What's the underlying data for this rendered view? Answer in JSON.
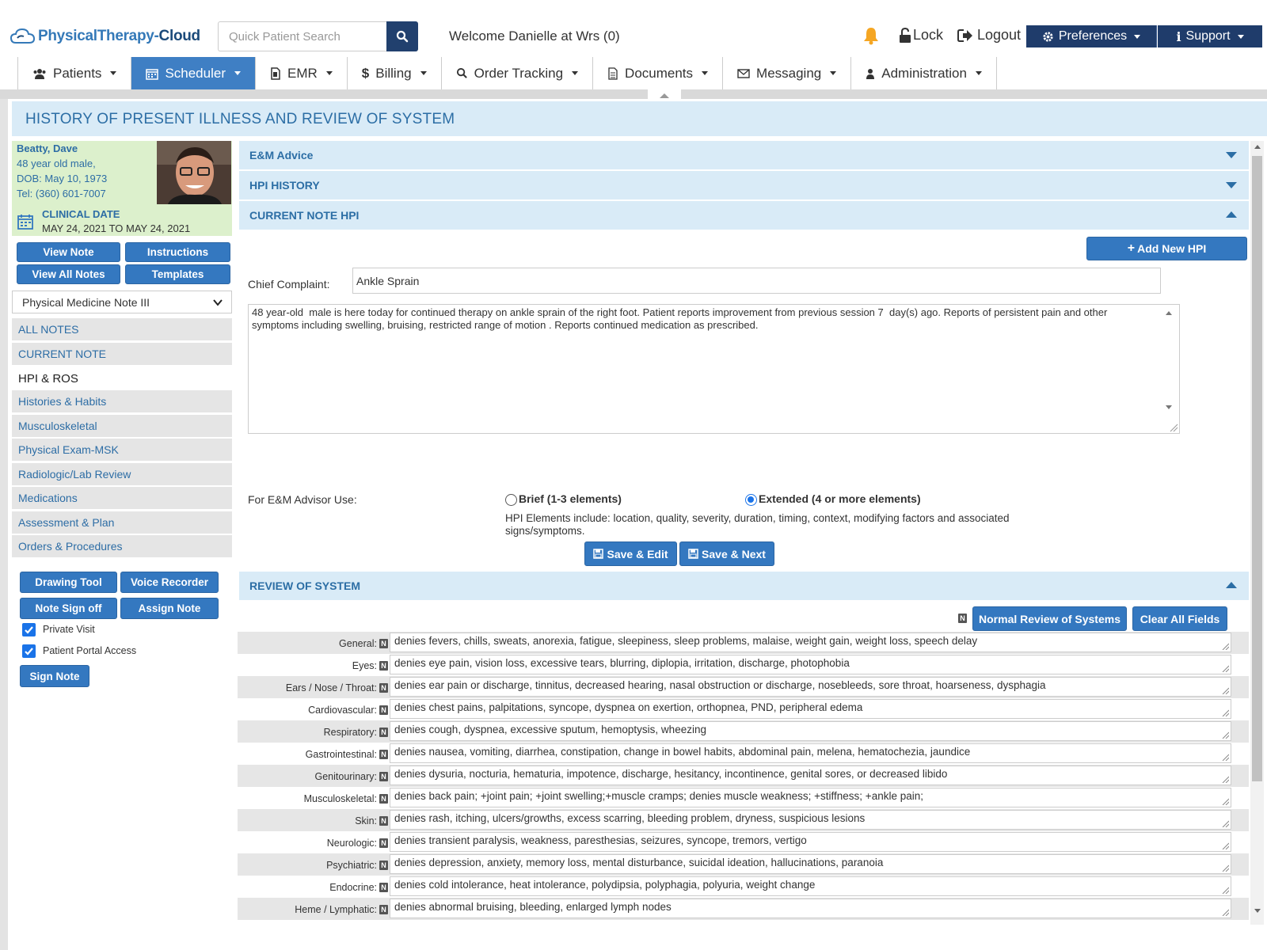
{
  "header": {
    "logo_part1": "PhysicalTherapy-",
    "logo_part2": "Cloud",
    "search_placeholder": "Quick Patient Search",
    "welcome": "Welcome Danielle at Wrs (0)",
    "lock": "Lock",
    "logout": "Logout",
    "preferences": "Preferences",
    "support": "Support"
  },
  "nav": {
    "items": [
      {
        "label": "Patients",
        "icon": "users-icon"
      },
      {
        "label": "Scheduler",
        "icon": "calendar-icon"
      },
      {
        "label": "EMR",
        "icon": "file-icon"
      },
      {
        "label": "Billing",
        "icon": "dollar-icon"
      },
      {
        "label": "Order Tracking",
        "icon": "search-icon"
      },
      {
        "label": "Documents",
        "icon": "document-icon"
      },
      {
        "label": "Messaging",
        "icon": "envelope-icon"
      },
      {
        "label": "Administration",
        "icon": "user-icon"
      }
    ],
    "active": "Scheduler"
  },
  "page": {
    "title": "HISTORY OF PRESENT ILLNESS AND REVIEW OF SYSTEM"
  },
  "patient": {
    "name": "Beatty, Dave",
    "age_sex": "48 year old male,",
    "dob": "DOB: May 10, 1973",
    "tel": "Tel: (360) 601-7007",
    "clinical_date_label": "CLINICAL DATE",
    "clinical_date_value": "MAY 24, 2021 TO MAY 24, 2021"
  },
  "sidebar": {
    "buttons": {
      "view_note": "View Note",
      "instructions": "Instructions",
      "view_all_notes": "View All Notes",
      "templates": "Templates"
    },
    "note_type": "Physical Medicine Note III",
    "items": [
      "ALL NOTES",
      "CURRENT NOTE",
      "HPI & ROS",
      "Histories & Habits",
      "Musculoskeletal",
      "Physical Exam-MSK",
      "Radiologic/Lab Review",
      "Medications",
      "Assessment & Plan",
      "Orders & Procedures"
    ],
    "current_item": "HPI & ROS",
    "tools": {
      "drawing_tool": "Drawing Tool",
      "voice_recorder": "Voice Recorder",
      "note_sign_off": "Note Sign off",
      "assign_note": "Assign Note",
      "sign_note": "Sign Note"
    },
    "private_visit": {
      "label": "Private Visit",
      "checked": true
    },
    "patient_portal": {
      "label": "Patient Portal Access",
      "checked": true
    }
  },
  "panels": {
    "em_advice": "E&M Advice",
    "hpi_history": "HPI HISTORY",
    "current_note_hpi": "CURRENT NOTE HPI",
    "review_of_system": "REVIEW OF SYSTEM"
  },
  "hpi": {
    "add_new": "Add New HPI",
    "chief_complaint_label": "Chief Complaint:",
    "chief_complaint_value": "Ankle Sprain",
    "narrative": "48 year-old  male is here today for continued therapy on ankle sprain of the right foot. Patient reports improvement from previous session 7  day(s) ago. Reports of persistent pain and other symptoms including swelling, bruising, restricted range of motion . Reports continued medication as prescribed.",
    "em_label": "For E&M Advisor Use:",
    "brief_label": "Brief (1-3 elements)",
    "extended_label": "Extended (4 or more elements)",
    "selected": "Extended (4 or more elements)",
    "elements_note": "HPI Elements include: location, quality, severity, duration, timing, context, modifying factors and associated signs/symptoms.",
    "save_edit": "Save & Edit",
    "save_next": "Save & Next"
  },
  "ros": {
    "badge": "N",
    "normal_button": "Normal Review of Systems",
    "clear_button": "Clear All Fields",
    "rows": [
      {
        "label": "General:",
        "value": "denies fevers, chills, sweats, anorexia, fatigue, sleepiness, sleep problems, malaise, weight gain, weight loss, speech delay"
      },
      {
        "label": "Eyes:",
        "value": "denies eye pain, vision loss, excessive tears, blurring, diplopia, irritation, discharge, photophobia"
      },
      {
        "label": "Ears / Nose / Throat:",
        "value": "denies ear pain or discharge, tinnitus, decreased hearing, nasal obstruction or discharge, nosebleeds, sore throat, hoarseness, dysphagia"
      },
      {
        "label": "Cardiovascular:",
        "value": "denies chest pains, palpitations, syncope, dyspnea on exertion, orthopnea, PND, peripheral edema"
      },
      {
        "label": "Respiratory:",
        "value": "denies cough, dyspnea, excessive sputum, hemoptysis, wheezing"
      },
      {
        "label": "Gastrointestinal:",
        "value": "denies nausea, vomiting, diarrhea, constipation, change in bowel habits, abdominal pain, melena, hematochezia, jaundice"
      },
      {
        "label": "Genitourinary:",
        "value": "denies dysuria, nocturia, hematuria, impotence, discharge, hesitancy, incontinence, genital sores, or decreased libido"
      },
      {
        "label": "Musculoskeletal:",
        "value": "denies back pain;  +joint pain;  +joint swelling;+muscle cramps; denies muscle weakness; +stiffness; +ankle pain;"
      },
      {
        "label": "Skin:",
        "value": "denies rash, itching, ulcers/growths, excess scarring, bleeding problem, dryness, suspicious lesions"
      },
      {
        "label": "Neurologic:",
        "value": "denies transient paralysis, weakness, paresthesias, seizures, syncope, tremors, vertigo"
      },
      {
        "label": "Psychiatric:",
        "value": "denies depression, anxiety, memory loss, mental disturbance, suicidal ideation, hallucinations, paranoia"
      },
      {
        "label": "Endocrine:",
        "value": "denies cold intolerance, heat intolerance, polydipsia, polyphagia, polyuria, weight change"
      },
      {
        "label": "Heme / Lymphatic:",
        "value": "denies abnormal bruising, bleeding, enlarged lymph nodes"
      }
    ]
  },
  "colors": {
    "brand_dark": "#1f3c6b",
    "brand_blue": "#3478c0",
    "panel_bg": "#d9ebf7",
    "patient_bg": "#dcf0cc",
    "bell": "#f5a623"
  }
}
